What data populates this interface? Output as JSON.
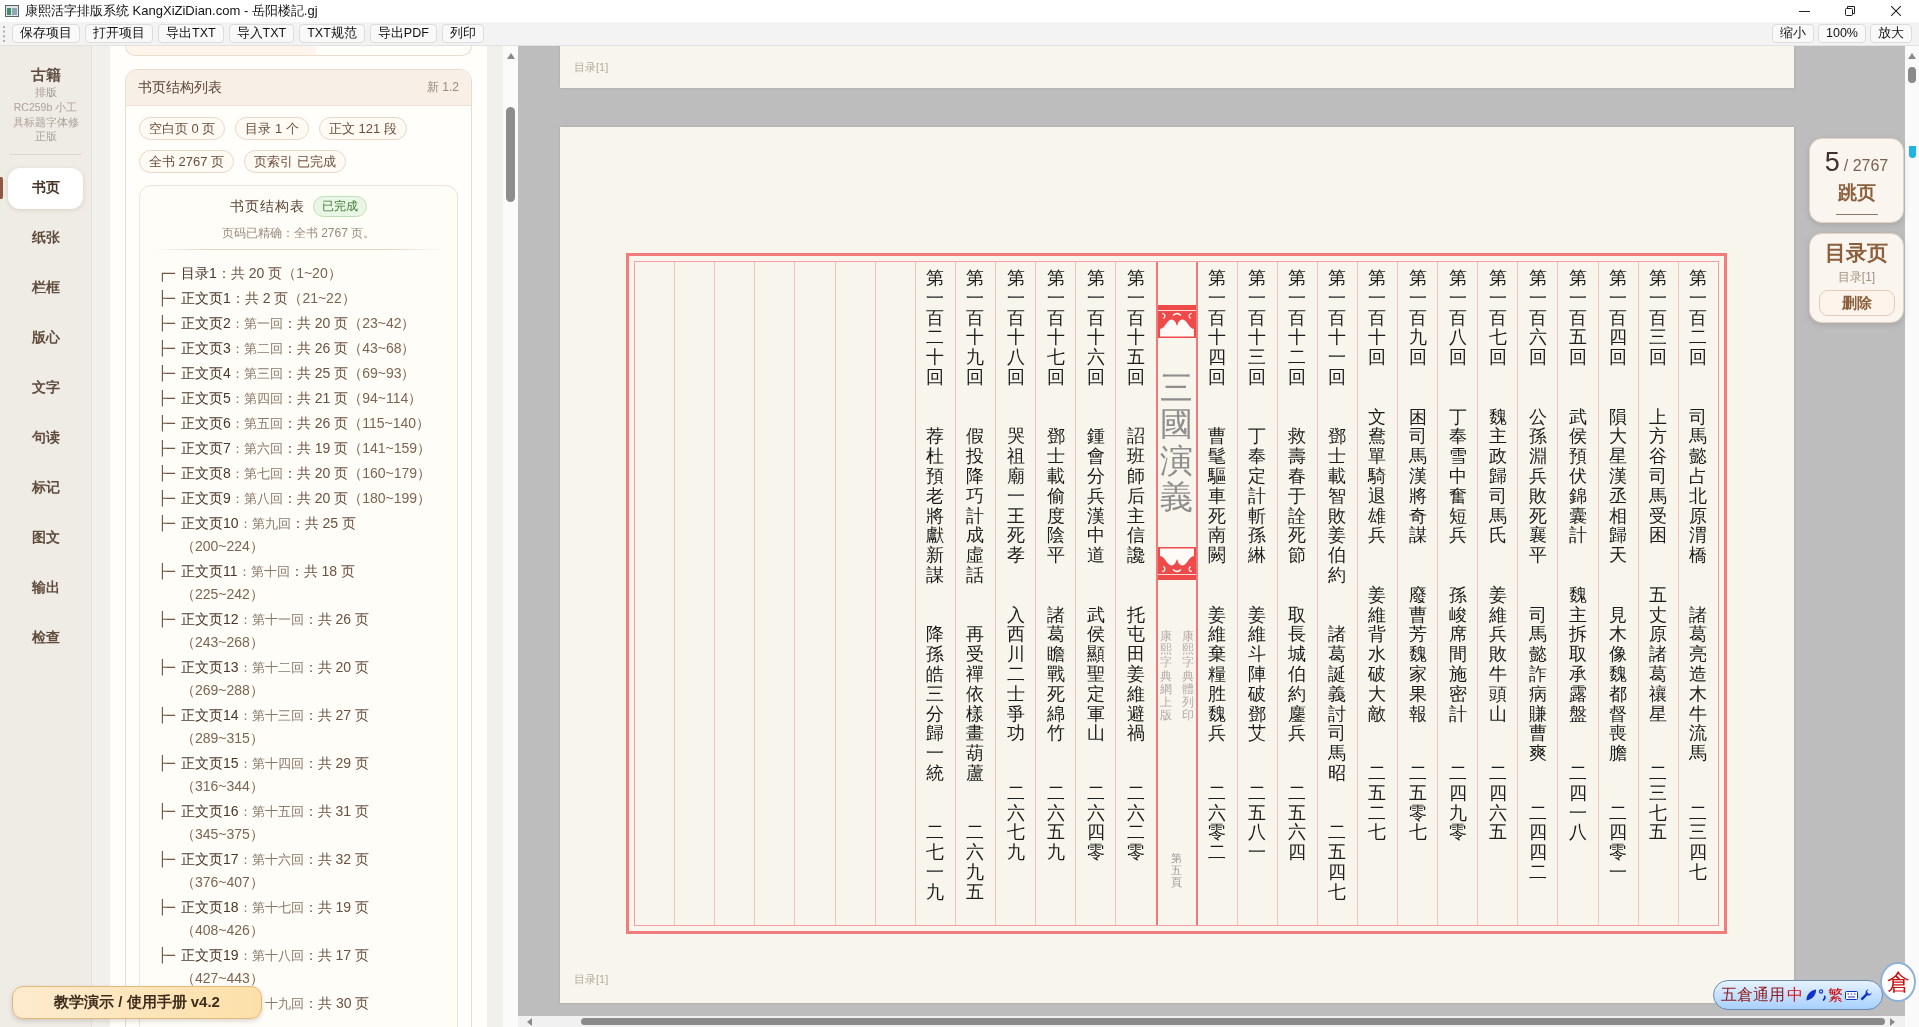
{
  "window": {
    "title": "康熙活字排版系统 KangXiZiDian.com - 岳阳楼記.gj"
  },
  "toolbar": {
    "buttons": [
      "保存项目",
      "打开项目",
      "导出TXT",
      "导入TXT",
      "TXT规范",
      "导出PDF",
      "列印"
    ],
    "zoom": [
      "缩小",
      "100%",
      "放大"
    ]
  },
  "sidebar": {
    "title": "古籍",
    "subtitle": "排版",
    "version": "RC259b 小工具标题字体修正版",
    "items": [
      {
        "label": "书页",
        "selected": true
      },
      {
        "label": "纸张",
        "selected": false
      },
      {
        "label": "栏框",
        "selected": false
      },
      {
        "label": "版心",
        "selected": false
      },
      {
        "label": "文字",
        "selected": false
      },
      {
        "label": "句读",
        "selected": false
      },
      {
        "label": "标记",
        "selected": false
      },
      {
        "label": "图文",
        "selected": false
      },
      {
        "label": "输出",
        "selected": false
      },
      {
        "label": "检查",
        "selected": false
      }
    ]
  },
  "structure_list": {
    "title": "书页结构列表",
    "version": "新 1.2",
    "chips": [
      "空白页 0 页",
      "目录 1 个",
      "正文 121 段",
      "全书 2767 页",
      "页索引 已完成"
    ],
    "table": {
      "title": "书页结构表",
      "status": "已完成",
      "summary": "页码已精确：全书 2767 页。",
      "entries": [
        {
          "branch": "┌─",
          "label": "目录1",
          "detail": "：共 20 页",
          "range": "（1~20）"
        },
        {
          "branch": "├─",
          "label": "正文页1",
          "detail": "：共 2 页",
          "range": "（21~22）"
        },
        {
          "branch": "├─",
          "label": "正文页2",
          "chapter": "：第一回",
          "detail": "：共 20 页",
          "range": "（23~42）"
        },
        {
          "branch": "├─",
          "label": "正文页3",
          "chapter": "：第二回",
          "detail": "：共 26 页",
          "range": "（43~68）"
        },
        {
          "branch": "├─",
          "label": "正文页4",
          "chapter": "：第三回",
          "detail": "：共 25 页",
          "range": "（69~93）"
        },
        {
          "branch": "├─",
          "label": "正文页5",
          "chapter": "：第四回",
          "detail": "：共 21 页",
          "range": "（94~114）"
        },
        {
          "branch": "├─",
          "label": "正文页6",
          "chapter": "：第五回",
          "detail": "：共 26 页",
          "range": "（115~140）"
        },
        {
          "branch": "├─",
          "label": "正文页7",
          "chapter": "：第六回",
          "detail": "：共 19 页",
          "range": "（141~159）"
        },
        {
          "branch": "├─",
          "label": "正文页8",
          "chapter": "：第七回",
          "detail": "：共 20 页",
          "range": "（160~179）"
        },
        {
          "branch": "├─",
          "label": "正文页9",
          "chapter": "：第八回",
          "detail": "：共 20 页",
          "range": "（180~199）"
        },
        {
          "branch": "├─",
          "label": "正文页10",
          "chapter": "：第九回",
          "detail": "：共 25 页",
          "range": "（200~224）"
        },
        {
          "branch": "├─",
          "label": "正文页11",
          "chapter": "：第十回",
          "detail": "：共 18 页",
          "range": "（225~242）"
        },
        {
          "branch": "├─",
          "label": "正文页12",
          "chapter": "：第十一回",
          "detail": "：共 26 页",
          "range": "（243~268）"
        },
        {
          "branch": "├─",
          "label": "正文页13",
          "chapter": "：第十二回",
          "detail": "：共 20 页",
          "range": "（269~288）"
        },
        {
          "branch": "├─",
          "label": "正文页14",
          "chapter": "：第十三回",
          "detail": "：共 27 页",
          "range": "（289~315）"
        },
        {
          "branch": "├─",
          "label": "正文页15",
          "chapter": "：第十四回",
          "detail": "：共 29 页",
          "range": "（316~344）"
        },
        {
          "branch": "├─",
          "label": "正文页16",
          "chapter": "：第十五回",
          "detail": "：共 31 页",
          "range": "（345~375）"
        },
        {
          "branch": "├─",
          "label": "正文页17",
          "chapter": "：第十六回",
          "detail": "：共 32 页",
          "range": "（376~407）"
        },
        {
          "branch": "├─",
          "label": "正文页18",
          "chapter": "：第十七回",
          "detail": "：共 19 页",
          "range": "（408~426）"
        },
        {
          "branch": "├─",
          "label": "正文页19",
          "chapter": "：第十八回",
          "detail": "：共 17 页",
          "range": "（427~443）"
        },
        {
          "chapter": "十九回",
          "detail": "：共 30 页"
        }
      ]
    }
  },
  "document": {
    "previous_page": {
      "footer": "目录[1]"
    },
    "page": {
      "footer": "目录[1]",
      "left_half": [
        {
          "number": "第一百二十回",
          "titles": [
            "荐杜預老將獻新謀",
            "降孫皓三分歸一統"
          ],
          "page": "二七一九"
        },
        {
          "number": "第一百十九回",
          "titles": [
            "假投降巧計成虛話",
            "再受禪依樣畫葫蘆"
          ],
          "page": "二六九五"
        },
        {
          "number": "第一百十八回",
          "titles": [
            "哭祖廟一王死孝",
            "入西川二士爭功"
          ],
          "page": "二六七九"
        },
        {
          "number": "第一百十七回",
          "titles": [
            "鄧士載偷度陰平",
            "諸葛瞻戰死綿竹"
          ],
          "page": "二六五九"
        },
        {
          "number": "第一百十六回",
          "titles": [
            "鍾會分兵漢中道",
            "武侯顯聖定軍山"
          ],
          "page": "二六四零"
        },
        {
          "number": "第一百十五回",
          "titles": [
            "詔班師后主信讒",
            "托屯田姜維避禍"
          ],
          "page": "二六二零"
        }
      ],
      "fold": {
        "title": "三國演義",
        "notes": [
          "康熙字典網上版",
          "康熙字典體列印"
        ],
        "page_number": "第五頁"
      },
      "right_half": [
        {
          "number": "第一百十四回",
          "titles": [
            "曹髦驅車死南闕",
            "姜維棄糧胜魏兵"
          ],
          "page": "二六零二"
        },
        {
          "number": "第一百十三回",
          "titles": [
            "丁奉定計斬孫綝",
            "姜維斗陣破鄧艾"
          ],
          "page": "二五八一"
        },
        {
          "number": "第一百十二回",
          "titles": [
            "救壽春于詮死節",
            "取長城伯約鏖兵"
          ],
          "page": "二五六四"
        },
        {
          "number": "第一百十一回",
          "titles": [
            "鄧士載智敗姜伯約",
            "諸葛誕義討司馬昭"
          ],
          "page": "二五四七"
        },
        {
          "number": "第一百十回",
          "titles": [
            "文鴦單騎退雄兵",
            "姜維背水破大敵"
          ],
          "page": "二五二七"
        },
        {
          "number": "第一百九回",
          "titles": [
            "困司馬漢將奇謀",
            "廢曹芳魏家果報"
          ],
          "page": "二五零七"
        },
        {
          "number": "第一百八回",
          "titles": [
            "丁奉雪中奮短兵",
            "孫峻席間施密計"
          ],
          "page": "二四九零"
        },
        {
          "number": "第一百七回",
          "titles": [
            "魏主政歸司馬氏",
            "姜維兵敗牛頭山"
          ],
          "page": "二四六五"
        },
        {
          "number": "第一百六回",
          "titles": [
            "公孫淵兵敗死襄平",
            "司馬懿詐病賺曹爽"
          ],
          "page": "二四四二"
        },
        {
          "number": "第一百五回",
          "titles": [
            "武侯預伏錦囊計",
            "魏主拆取承露盤"
          ],
          "page": "二四一八"
        },
        {
          "number": "第一百四回",
          "titles": [
            "隕大星漢丞相歸天",
            "見木像魏都督喪膽"
          ],
          "page": "二四零一"
        },
        {
          "number": "第一百三回",
          "titles": [
            "上方谷司馬受困",
            "五丈原諸葛禳星"
          ],
          "page": "二三七五"
        },
        {
          "number": "第一百二回",
          "titles": [
            "司馬懿占北原渭橋",
            "諸葛亮造木牛流馬"
          ],
          "page": "二三四七"
        }
      ]
    }
  },
  "page_jump": {
    "current": "5",
    "total": "/ 2767",
    "button": "跳页"
  },
  "toc_card": {
    "title": "目录页",
    "entry": "目录[1]",
    "button": "删除"
  },
  "help_button": "教学演示 / 使用手册 v4.2",
  "ime": {
    "name": "五倉通用",
    "mode": "中",
    "script": "繁",
    "logo": "倉"
  }
}
